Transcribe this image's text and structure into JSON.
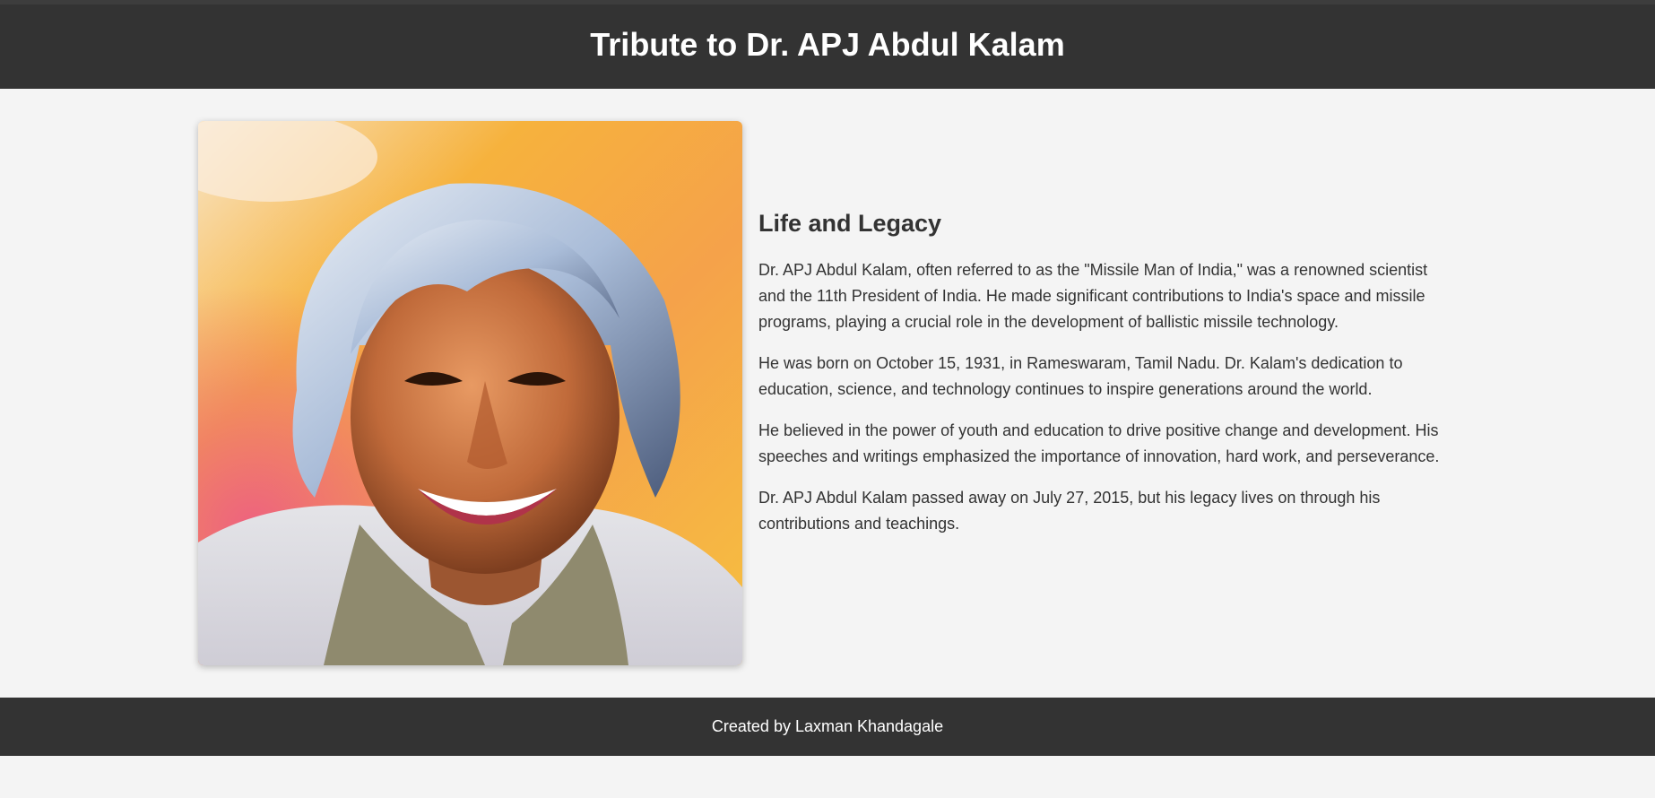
{
  "header": {
    "title": "Tribute to Dr. APJ Abdul Kalam"
  },
  "portrait": {
    "description_icon": "portrait-image"
  },
  "main": {
    "heading": "Life and Legacy",
    "paragraphs": [
      "Dr. APJ Abdul Kalam, often referred to as the \"Missile Man of India,\" was a renowned scientist and the 11th President of India. He made significant contributions to India's space and missile programs, playing a crucial role in the development of ballistic missile technology.",
      "He was born on October 15, 1931, in Rameswaram, Tamil Nadu. Dr. Kalam's dedication to education, science, and technology continues to inspire generations around the world.",
      "He believed in the power of youth and education to drive positive change and development. His speeches and writings emphasized the importance of innovation, hard work, and perseverance.",
      "Dr. APJ Abdul Kalam passed away on July 27, 2015, but his legacy lives on through his contributions and teachings."
    ]
  },
  "footer": {
    "credit": "Created by Laxman Khandagale"
  },
  "colors": {
    "header_bg": "#333333",
    "page_bg": "#f4f4f4",
    "text": "#333333"
  }
}
